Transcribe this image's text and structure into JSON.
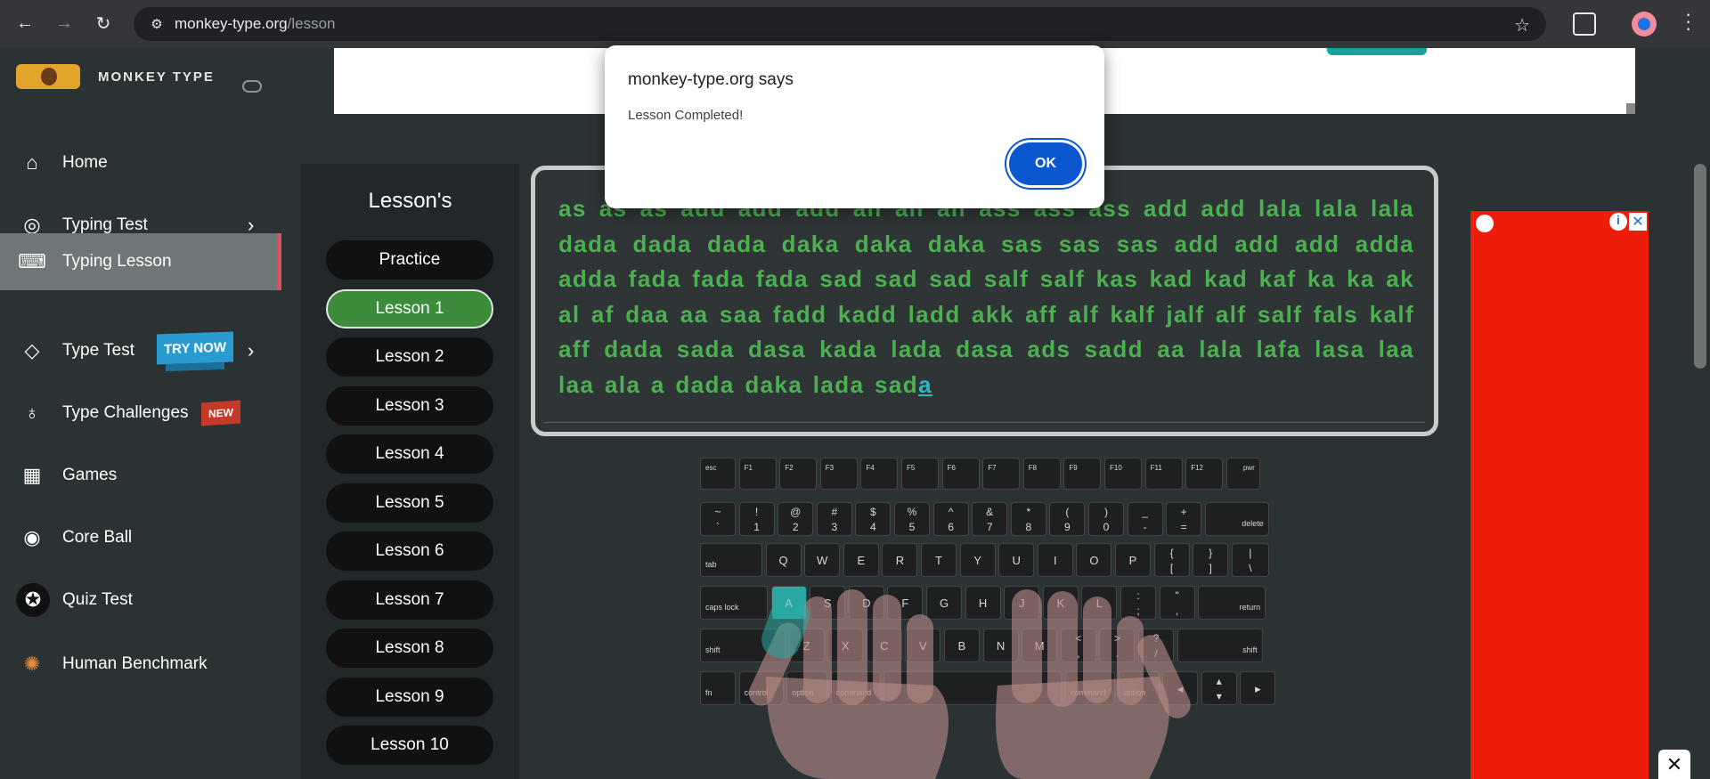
{
  "browser": {
    "url_domain": "monkey-type.org",
    "url_path": "/lesson"
  },
  "sidebar": {
    "logo_text": "MONKEY TYPE",
    "items": [
      {
        "label": "Home",
        "icon": "home-icon"
      },
      {
        "label": "Typing Test",
        "icon": "github-icon"
      },
      {
        "label": "Typing Lesson",
        "icon": "keyboard-icon"
      },
      {
        "label": "Type Test",
        "icon": "gitlab-icon",
        "badge": "TRY NOW"
      },
      {
        "label": "Type Challenges",
        "icon": "award-icon",
        "badge": "NEW"
      },
      {
        "label": "Games",
        "icon": "grid-icon"
      },
      {
        "label": "Core Ball",
        "icon": "target-icon"
      },
      {
        "label": "Quiz Test",
        "icon": "bulb-avatar-icon"
      },
      {
        "label": "Human Benchmark",
        "icon": "brain-icon"
      }
    ]
  },
  "lessons": {
    "title": "Lesson's",
    "items": [
      "Practice",
      "Lesson 1",
      "Lesson 2",
      "Lesson 3",
      "Lesson 4",
      "Lesson 5",
      "Lesson 6",
      "Lesson 7",
      "Lesson 8",
      "Lesson 9",
      "Lesson 10"
    ],
    "active": "Lesson 1"
  },
  "typing": {
    "text": "as as as add add add all all all ass ass ass add add lala lala lala dada dada dada daka daka daka sas sas sas add add add adda adda fada fada fada sad sad sad salf salf kas kad kad kaf ka ka ak al af daa aa saa fadd kadd ladd akk aff alf kalf jalf alf salf fals kalf aff dada sada dasa kada lada dasa ads sadd aa lala lafa lasa laa laa ala a dada daka lada sad",
    "current_char": "a"
  },
  "keyboard": {
    "rows": [
      [
        {
          "t": "esc"
        },
        {
          "t": "F1"
        },
        {
          "t": "F2"
        },
        {
          "t": "F3"
        },
        {
          "t": "F4"
        },
        {
          "t": "F5"
        },
        {
          "t": "F6"
        },
        {
          "t": "F7"
        },
        {
          "t": "F8"
        },
        {
          "t": "F9"
        },
        {
          "t": "F10"
        },
        {
          "t": "F11"
        },
        {
          "t": "F12"
        },
        {
          "t": "pwr"
        }
      ],
      [
        {
          "t": "~",
          "b": "`"
        },
        {
          "t": "!",
          "b": "1"
        },
        {
          "t": "@",
          "b": "2"
        },
        {
          "t": "#",
          "b": "3"
        },
        {
          "t": "$",
          "b": "4"
        },
        {
          "t": "%",
          "b": "5"
        },
        {
          "t": "^",
          "b": "6"
        },
        {
          "t": "&",
          "b": "7"
        },
        {
          "t": "*",
          "b": "8"
        },
        {
          "t": "(",
          "b": "9"
        },
        {
          "t": ")",
          "b": "0"
        },
        {
          "t": "_",
          "b": "-"
        },
        {
          "t": "+",
          "b": "="
        },
        {
          "t": "delete"
        }
      ],
      [
        {
          "t": "tab"
        },
        {
          "t": "Q"
        },
        {
          "t": "W"
        },
        {
          "t": "E"
        },
        {
          "t": "R"
        },
        {
          "t": "T"
        },
        {
          "t": "Y"
        },
        {
          "t": "U"
        },
        {
          "t": "I"
        },
        {
          "t": "O"
        },
        {
          "t": "P"
        },
        {
          "t": "{",
          "b": "["
        },
        {
          "t": "}",
          "b": "]"
        },
        {
          "t": "|",
          "b": "\\"
        }
      ],
      [
        {
          "t": "caps lock"
        },
        {
          "t": "A"
        },
        {
          "t": "S"
        },
        {
          "t": "D"
        },
        {
          "t": "F"
        },
        {
          "t": "G"
        },
        {
          "t": "H"
        },
        {
          "t": "J"
        },
        {
          "t": "K"
        },
        {
          "t": "L"
        },
        {
          "t": ":",
          "b": ";"
        },
        {
          "t": "\"",
          "b": ","
        },
        {
          "t": "return"
        }
      ],
      [
        {
          "t": "shift"
        },
        {
          "t": "Z"
        },
        {
          "t": "X"
        },
        {
          "t": "C"
        },
        {
          "t": "V"
        },
        {
          "t": "B"
        },
        {
          "t": "N"
        },
        {
          "t": "M"
        },
        {
          "t": "<",
          "b": ","
        },
        {
          "t": ">",
          "b": "."
        },
        {
          "t": "?",
          "b": "/"
        },
        {
          "t": "shift"
        }
      ],
      [
        {
          "t": "fn"
        },
        {
          "t": "control"
        },
        {
          "t": "option"
        },
        {
          "t": "command"
        },
        {
          "t": ""
        },
        {
          "t": "command"
        },
        {
          "t": "option"
        },
        {
          "t": "◂"
        },
        {
          "t": "▴",
          "b": "▾"
        },
        {
          "t": "▸"
        }
      ]
    ],
    "highlighted_key": "A"
  },
  "dialog": {
    "title": "monkey-type.org says",
    "message": "Lesson Completed!",
    "ok_label": "OK"
  },
  "colors": {
    "typed_text": "#4caf50",
    "active_lesson": "#3c8c3c",
    "highlight_key": "#2aa9a3",
    "dialog_button": "#0b57d0",
    "ad_red": "#ee1c0b"
  }
}
